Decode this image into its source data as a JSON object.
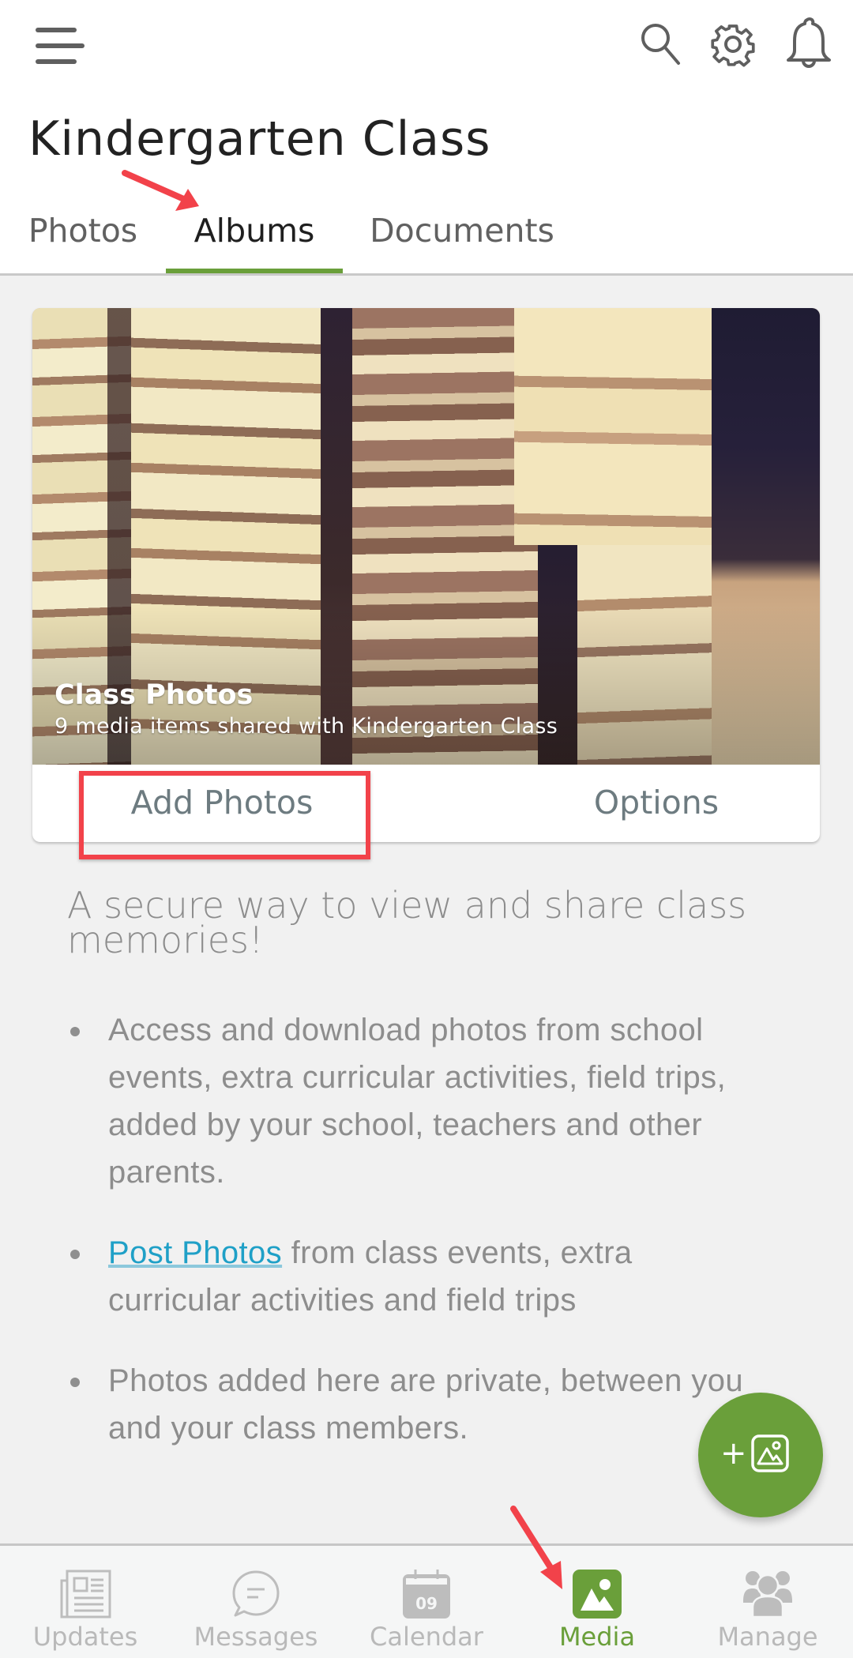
{
  "header": {
    "menu_icon": "hamburger-menu-icon",
    "title": "Kindergarten Class",
    "actions": [
      {
        "name": "search",
        "icon": "search-icon"
      },
      {
        "name": "settings",
        "icon": "gear-icon"
      },
      {
        "name": "notifications",
        "icon": "bell-icon"
      }
    ]
  },
  "tabs": [
    {
      "label": "Photos",
      "active": false
    },
    {
      "label": "Albums",
      "active": true
    },
    {
      "label": "Documents",
      "active": false
    }
  ],
  "album": {
    "title": "Class Photos",
    "subtitle": "9 media items shared with Kindergarten Class",
    "cover_image": "stacked books photo",
    "actions": {
      "add_photos": "Add Photos",
      "options": "Options"
    }
  },
  "info": {
    "heading": "A secure way to view and share class memories!",
    "bullets": [
      {
        "text": "Access and download photos from school events, extra curricular activities, field trips, added by your school, teachers and other parents."
      },
      {
        "link": "Post Photos",
        "text": " from class events, extra curricular activities and field trips"
      },
      {
        "text": "Photos added here are private, between you and your class members."
      }
    ]
  },
  "fab": {
    "label": "+",
    "icon": "add-photo-icon"
  },
  "bottom_nav": [
    {
      "label": "Updates",
      "icon": "newspaper-icon",
      "active": false
    },
    {
      "label": "Messages",
      "icon": "chat-bubble-icon",
      "active": false
    },
    {
      "label": "Calendar",
      "icon": "calendar-icon",
      "calendar_day": "09",
      "active": false
    },
    {
      "label": "Media",
      "icon": "image-icon",
      "active": true
    },
    {
      "label": "Manage",
      "icon": "people-icon",
      "active": false
    }
  ],
  "colors": {
    "accent": "#6a9f3a",
    "link": "#1fa0c7",
    "annotation": "#f2424a"
  }
}
